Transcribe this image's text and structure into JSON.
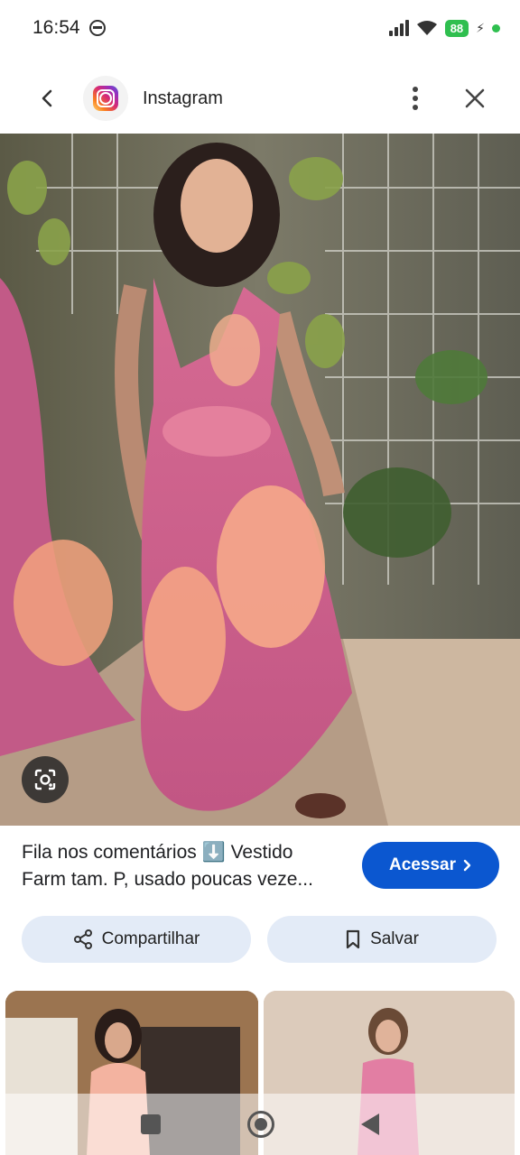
{
  "status_bar": {
    "time": "16:54",
    "battery": "88",
    "accent_green": "#2fbf4f"
  },
  "header": {
    "title": "Instagram",
    "icons": [
      "back-arrow-icon",
      "instagram-logo-icon",
      "more-vert-icon",
      "close-icon"
    ]
  },
  "caption": {
    "line1": "Fila nos comentários ⬇️ Vestido",
    "line2": "Farm tam. P, usado poucas veze..."
  },
  "visit_button": {
    "label": "Acessar",
    "color": "#0b57d0"
  },
  "actions": {
    "share_label": "Compartilhar",
    "save_label": "Salvar",
    "button_bg": "#e3ebf7"
  },
  "icons": {
    "lens": "google-lens-icon",
    "share": "share-icon",
    "save": "bookmark-icon"
  }
}
